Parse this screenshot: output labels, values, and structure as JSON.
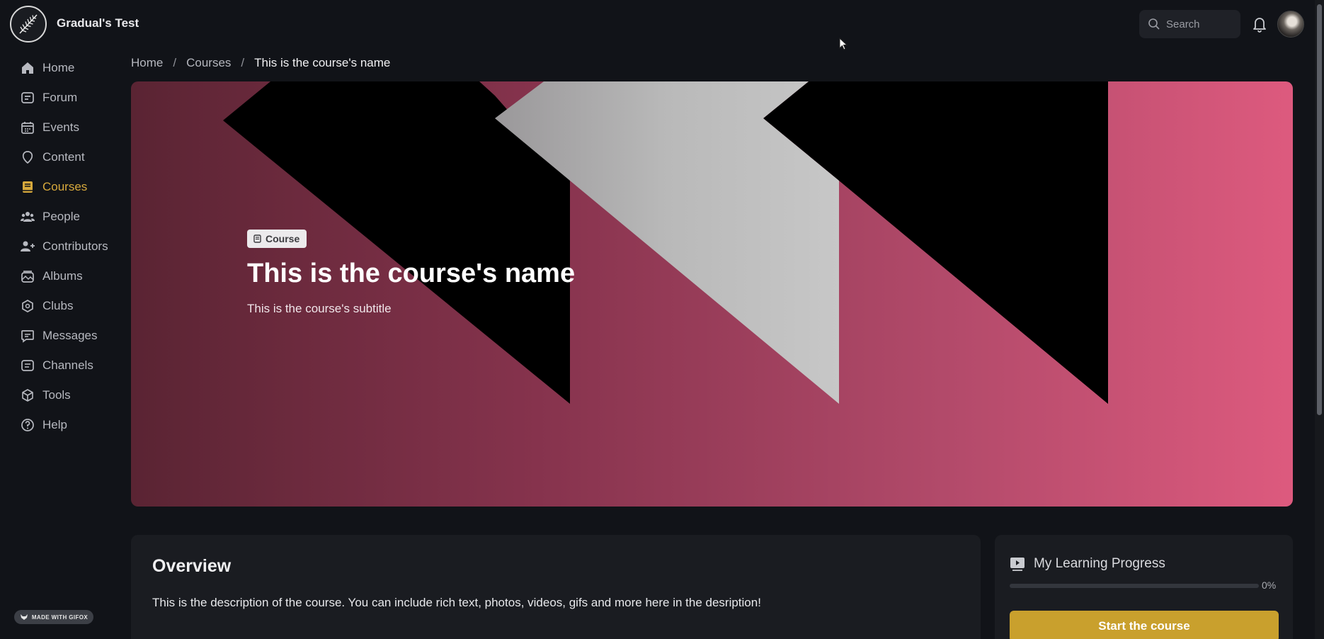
{
  "app": {
    "site_name": "Gradual's Test"
  },
  "search": {
    "placeholder": "Search"
  },
  "sidebar": {
    "items": [
      {
        "label": "Home",
        "icon": "home-icon"
      },
      {
        "label": "Forum",
        "icon": "forum-icon"
      },
      {
        "label": "Events",
        "icon": "calendar-icon"
      },
      {
        "label": "Content",
        "icon": "content-icon"
      },
      {
        "label": "Courses",
        "icon": "book-icon",
        "active": true
      },
      {
        "label": "People",
        "icon": "people-icon"
      },
      {
        "label": "Contributors",
        "icon": "contributors-icon"
      },
      {
        "label": "Albums",
        "icon": "albums-icon"
      },
      {
        "label": "Clubs",
        "icon": "clubs-icon"
      },
      {
        "label": "Messages",
        "icon": "messages-icon"
      },
      {
        "label": "Channels",
        "icon": "channels-icon"
      },
      {
        "label": "Tools",
        "icon": "cube-icon"
      },
      {
        "label": "Help",
        "icon": "help-icon"
      }
    ],
    "gifox_label": "MADE WITH GIFOX"
  },
  "breadcrumb": {
    "home": "Home",
    "courses": "Courses",
    "current": "This is the course's name",
    "separator": "/"
  },
  "hero": {
    "badge": "Course",
    "title": "This is the course's name",
    "subtitle": "This is the course's subtitle"
  },
  "overview": {
    "heading": "Overview",
    "description": "This is the description of the course. You can include rich text, photos, videos, gifs and more here in the desription!"
  },
  "progress": {
    "title": "My Learning Progress",
    "percent_label": "0%",
    "value": 0,
    "button_label": "Start the course"
  },
  "colors": {
    "accent": "#c9a02d",
    "active_nav": "#d7a93c",
    "background": "#111318",
    "card": "#1a1c21"
  }
}
